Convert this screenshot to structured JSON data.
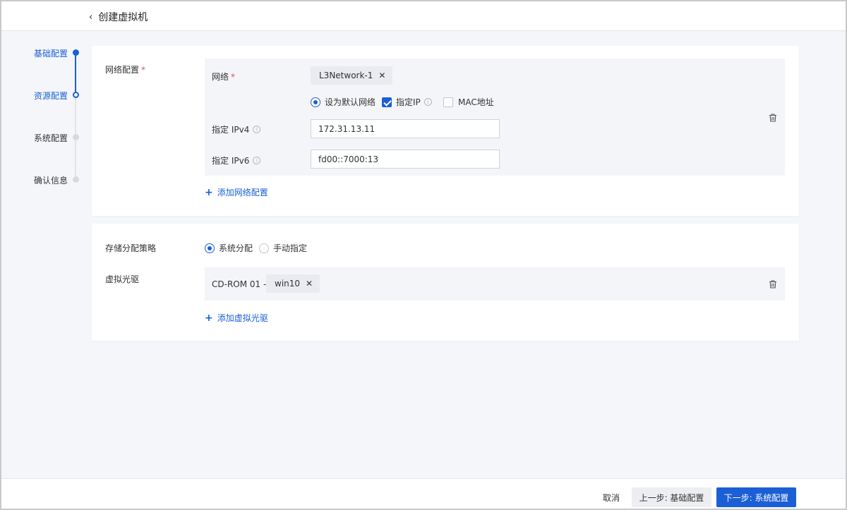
{
  "header": {
    "back_icon": "chevron-left-icon",
    "title": "创建虚拟机"
  },
  "steps": [
    {
      "label": "基础配置",
      "state": "done"
    },
    {
      "label": "资源配置",
      "state": "current"
    },
    {
      "label": "系统配置",
      "state": "pending"
    },
    {
      "label": "确认信息",
      "state": "pending"
    }
  ],
  "network": {
    "section_label": "网络配置",
    "required_mark": "*",
    "network_label": "网络",
    "network_tag": "L3Network-1",
    "options": {
      "default_network": "设为默认网络",
      "specify_ip": "指定IP",
      "mac_address": "MAC地址"
    },
    "ipv4_label": "指定 IPv4",
    "ipv4_value": "172.31.13.11",
    "ipv6_label": "指定 IPv6",
    "ipv6_value": "fd00::7000:13",
    "add_label": "添加网络配置"
  },
  "storage": {
    "strategy_label": "存储分配策略",
    "options": {
      "system": "系统分配",
      "manual": "手动指定"
    },
    "cdrom_label": "虚拟光驱",
    "cdrom_prefix": "CD-ROM 01 -",
    "cdrom_tag": "win10",
    "add_label": "添加虚拟光驱"
  },
  "footer": {
    "cancel": "取消",
    "prev": "上一步: 基础配置",
    "next": "下一步: 系统配置"
  },
  "colors": {
    "primary": "#1a5fd6",
    "required": "#e34d59"
  }
}
